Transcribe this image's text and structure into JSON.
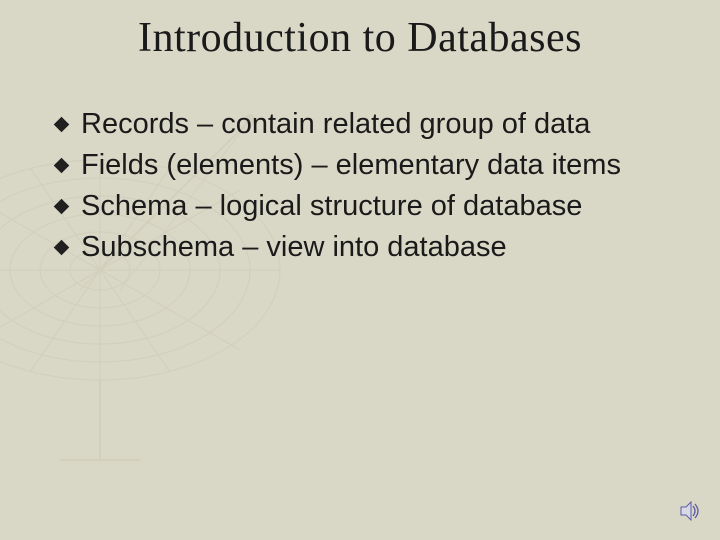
{
  "title": "Introduction to Databases",
  "bullets": [
    "Records – contain related group of data",
    "Fields (elements) – elementary data items",
    "Schema – logical structure of database",
    "Subschema – view into database"
  ],
  "icons": {
    "sound": "sound-icon"
  }
}
